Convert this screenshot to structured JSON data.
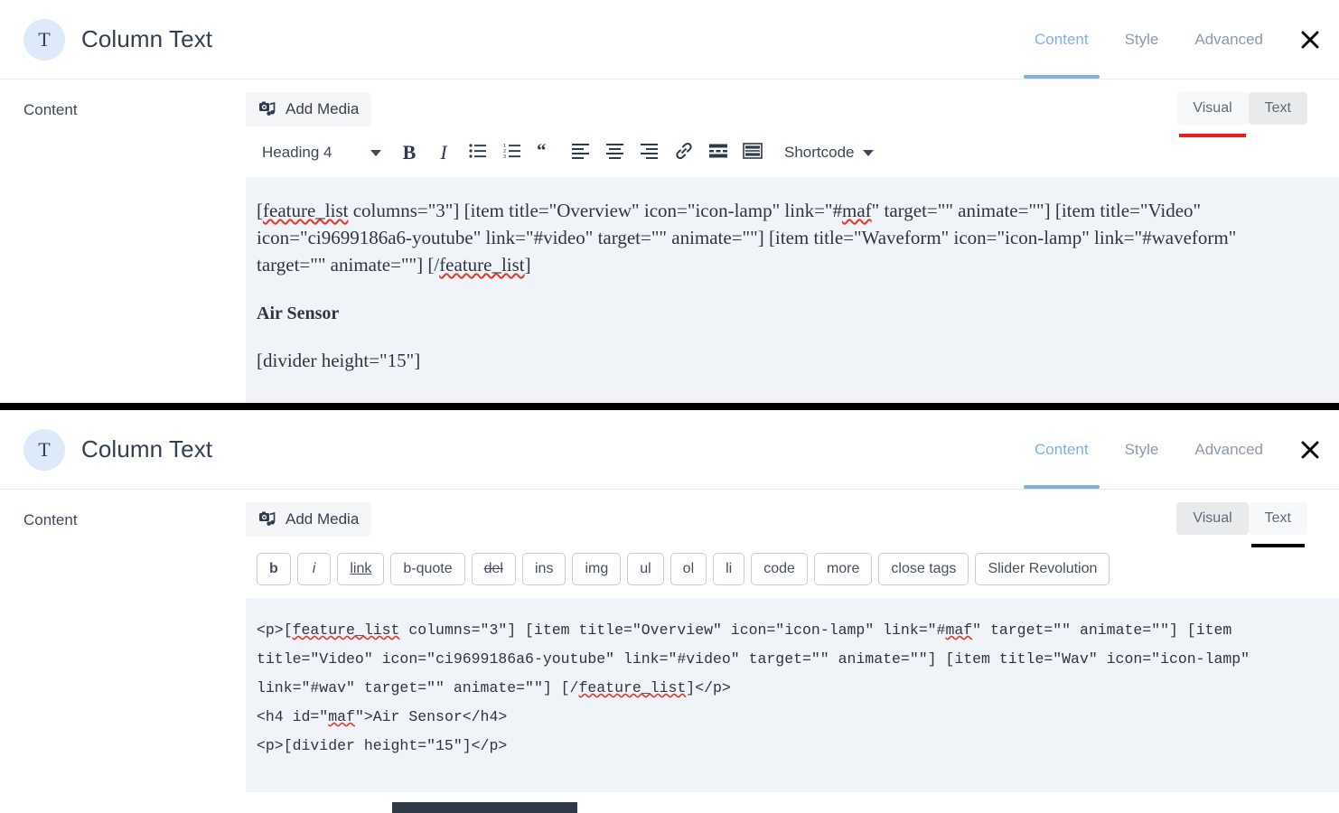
{
  "panels": [
    {
      "id": "visual-panel",
      "header": {
        "avatar_letter": "T",
        "title": "Column Text",
        "tabs": [
          {
            "label": "Content",
            "active": true
          },
          {
            "label": "Style",
            "active": false
          },
          {
            "label": "Advanced",
            "active": false
          }
        ],
        "close_icon": "close-icon"
      },
      "field_label": "Content",
      "add_media_label": "Add Media",
      "add_media_icon": "add-media-icon",
      "mode_tabs": {
        "visual_label": "Visual",
        "text_label": "Text",
        "active": "Visual",
        "annotation_color": "#ee1b1b"
      },
      "toolbar": {
        "format_value": "Heading 4",
        "buttons": [
          {
            "name": "bold-icon",
            "glyph": "B"
          },
          {
            "name": "italic-icon",
            "glyph": "I"
          },
          {
            "name": "bullet-list-icon",
            "glyph": ""
          },
          {
            "name": "numbered-list-icon",
            "glyph": ""
          },
          {
            "name": "blockquote-icon",
            "glyph": ""
          },
          {
            "name": "align-left-icon",
            "glyph": ""
          },
          {
            "name": "align-center-icon",
            "glyph": ""
          },
          {
            "name": "align-right-icon",
            "glyph": ""
          },
          {
            "name": "insert-link-icon",
            "glyph": ""
          },
          {
            "name": "read-more-icon",
            "glyph": ""
          },
          {
            "name": "toolbar-toggle-icon",
            "glyph": ""
          }
        ],
        "shortcode_label": "Shortcode"
      },
      "content": {
        "paragraph_parts": [
          {
            "t": "[",
            "sp": false
          },
          {
            "t": "feature_list",
            "sp": true
          },
          {
            "t": " columns=\"3\"] [item title=\"Overview\" icon=\"icon-lamp\" link=\"#",
            "sp": false
          },
          {
            "t": "maf",
            "sp": true
          },
          {
            "t": "\" target=\"\" animate=\"\"] [item title=\"Video\" icon=\"ci9699186a6-youtube\" link=\"#video\" target=\"\" animate=\"\"] [item title=\"Waveform\" icon=\"icon-lamp\" link=\"#waveform\" target=\"\" animate=\"\"] [/",
            "sp": false
          },
          {
            "t": "feature_list",
            "sp": true
          },
          {
            "t": "]",
            "sp": false
          }
        ],
        "heading": "Air Sensor",
        "divider_shortcode": "[divider height=\"15\"]"
      }
    },
    {
      "id": "text-panel",
      "header": {
        "avatar_letter": "T",
        "title": "Column Text",
        "tabs": [
          {
            "label": "Content",
            "active": true
          },
          {
            "label": "Style",
            "active": false
          },
          {
            "label": "Advanced",
            "active": false
          }
        ],
        "close_icon": "close-icon"
      },
      "field_label": "Content",
      "add_media_label": "Add Media",
      "add_media_icon": "add-media-icon",
      "mode_tabs": {
        "visual_label": "Visual",
        "text_label": "Text",
        "active": "Text",
        "annotation_color": "#000000"
      },
      "quicktags": [
        {
          "label": "b",
          "style": "bold"
        },
        {
          "label": "i",
          "style": "italic"
        },
        {
          "label": "link",
          "style": "underline"
        },
        {
          "label": "b-quote",
          "style": "normal"
        },
        {
          "label": "del",
          "style": "strikethrough"
        },
        {
          "label": "ins",
          "style": "normal"
        },
        {
          "label": "img",
          "style": "normal"
        },
        {
          "label": "ul",
          "style": "normal"
        },
        {
          "label": "ol",
          "style": "normal"
        },
        {
          "label": "li",
          "style": "normal"
        },
        {
          "label": "code",
          "style": "normal"
        },
        {
          "label": "more",
          "style": "normal"
        },
        {
          "label": "close tags",
          "style": "normal"
        },
        {
          "label": "Slider Revolution",
          "style": "normal"
        }
      ],
      "code": {
        "block_parts": [
          {
            "t": "<p>[",
            "sp": false
          },
          {
            "t": "feature_list",
            "sp": true
          },
          {
            "t": " columns=\"3\"] [item title=\"Overview\" icon=\"icon-lamp\" link=\"#",
            "sp": false
          },
          {
            "t": "maf",
            "sp": true
          },
          {
            "t": "\" target=\"\" animate=\"\"] [item title=\"Video\" icon=\"ci9699186a6-youtube\" link=\"#video\" target=\"\" animate=\"\"] [item title=\"Wav\" icon=\"icon-lamp\" link=\"#wav\" target=\"\" animate=\"\"] [/",
            "sp": false
          },
          {
            "t": "feature_list",
            "sp": true
          },
          {
            "t": "]</p>",
            "sp": false
          }
        ],
        "line_h4_parts": [
          {
            "t": "<h4 id=\"",
            "sp": false
          },
          {
            "t": "maf",
            "sp": true
          },
          {
            "t": "\">Air Sensor</h4>",
            "sp": false
          }
        ],
        "line_divider": "<p>[divider height=\"15\"]</p>"
      }
    }
  ],
  "colors": {
    "accent_blue": "#7fb1e8",
    "editor_bg": "#f0f3f8",
    "title_text": "#33404f",
    "red_annotation": "#ee1b1b",
    "black_annotation": "#000000"
  }
}
